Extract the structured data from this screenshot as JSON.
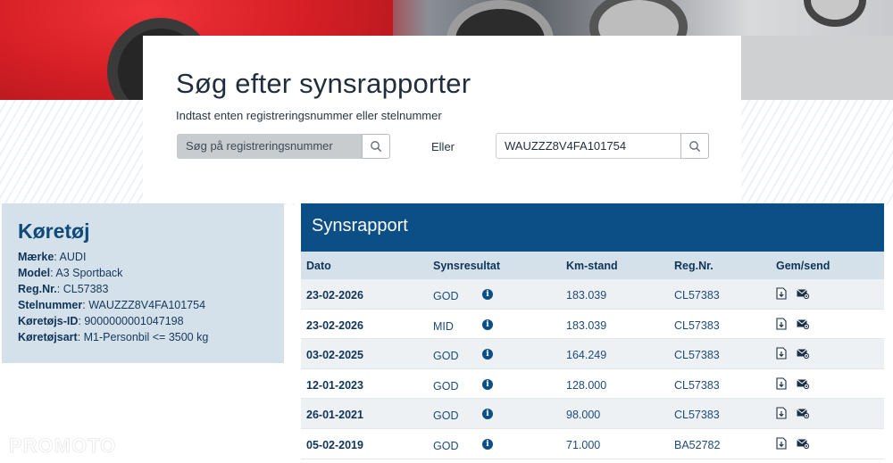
{
  "search": {
    "title": "Søg efter synsrapporter",
    "subtitle": "Indtast enten registreringsnummer eller stelnummer",
    "reg_placeholder": "Søg på registreringsnummer",
    "or_label": "Eller",
    "vin_value": "WAUZZZ8V4FA101754"
  },
  "vehicle": {
    "heading": "Køretøj",
    "rows": [
      {
        "label": "Mærke",
        "value": ": AUDI"
      },
      {
        "label": "Model",
        "value": ": A3 Sportback"
      },
      {
        "label": "Reg.Nr.",
        "value": ": CL57383"
      },
      {
        "label": "Stelnummer",
        "value": ": WAUZZZ8V4FA101754"
      },
      {
        "label": "Køretøjs-ID",
        "value": ": 9000000001047198"
      },
      {
        "label": "Køretøjsart",
        "value": ": M1-Personbil <= 3500 kg"
      }
    ]
  },
  "report": {
    "heading": "Synsrapport",
    "columns": [
      "Dato",
      "Synsresultat",
      "Km-stand",
      "Reg.Nr.",
      "Gem/send"
    ],
    "rows": [
      {
        "date": "23-02-2026",
        "result": "GOD",
        "km": "183.039",
        "reg": "CL57383"
      },
      {
        "date": "23-02-2026",
        "result": "MID",
        "km": "183.039",
        "reg": "CL57383"
      },
      {
        "date": "03-02-2025",
        "result": "GOD",
        "km": "164.249",
        "reg": "CL57383"
      },
      {
        "date": "12-01-2023",
        "result": "GOD",
        "km": "128.000",
        "reg": "CL57383"
      },
      {
        "date": "26-01-2021",
        "result": "GOD",
        "km": "98.000",
        "reg": "CL57383"
      },
      {
        "date": "05-02-2019",
        "result": "GOD",
        "km": "71.000",
        "reg": "BA52782"
      }
    ]
  },
  "icons": {
    "search": "search-icon",
    "info": "info-icon",
    "pdf": "download-pdf-icon",
    "mail": "send-mail-icon"
  },
  "colors": {
    "primary": "#0b4f86",
    "panel": "#d5e1ea"
  }
}
